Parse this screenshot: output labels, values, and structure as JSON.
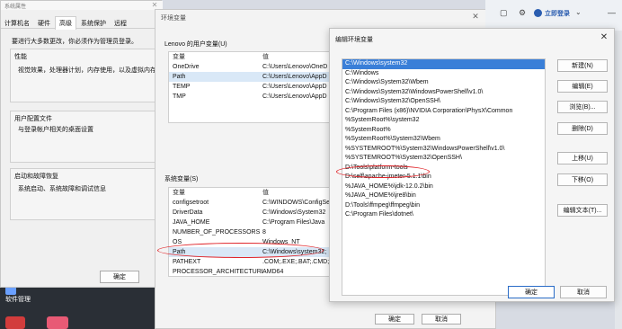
{
  "sysprop": {
    "title": "系统属性",
    "tabs": [
      "计算机名",
      "硬件",
      "高级",
      "系统保护",
      "远程"
    ],
    "admin_note": "要进行大多数更改，你必须作为管理员登录。",
    "perf_label": "性能",
    "perf_text": "视觉效果，处理器计划，内存使用，以及虚拟内存",
    "profile_label": "用户配置文件",
    "profile_text": "与登录帐户相关的桌面设置",
    "startup_label": "启动和故障恢复",
    "startup_text": "系统启动、系统故障和调试信息",
    "ok": "确定"
  },
  "desktop": {
    "label": "软件管理"
  },
  "envvar": {
    "title": "环境变量",
    "user_section": "Lenovo 的用户变量(U)",
    "col_var": "变量",
    "col_val": "值",
    "user_vars": [
      {
        "name": "OneDrive",
        "value": "C:\\Users\\Lenovo\\OneD"
      },
      {
        "name": "Path",
        "value": "C:\\Users\\Lenovo\\AppD"
      },
      {
        "name": "TEMP",
        "value": "C:\\Users\\Lenovo\\AppD"
      },
      {
        "name": "TMP",
        "value": "C:\\Users\\Lenovo\\AppD"
      }
    ],
    "system_section": "系统变量(S)",
    "sys_vars": [
      {
        "name": "configsetroot",
        "value": "C:\\WINDOWS\\ConfigSe"
      },
      {
        "name": "DriverData",
        "value": "C:\\Windows\\System32"
      },
      {
        "name": "JAVA_HOME",
        "value": "C:\\Program Files\\Java"
      },
      {
        "name": "NUMBER_OF_PROCESSORS",
        "value": "8"
      },
      {
        "name": "OS",
        "value": "Windows_NT"
      },
      {
        "name": "Path",
        "value": "C:\\Windows\\system32;"
      },
      {
        "name": "PATHEXT",
        "value": ".COM;.EXE;.BAT;.CMD;."
      },
      {
        "name": "PROCESSOR_ARCHITECTURE",
        "value": "AMD64"
      }
    ],
    "ok": "确定",
    "cancel": "取消"
  },
  "browser": {
    "login": "立即登录"
  },
  "editenv": {
    "title": "编辑环境变量",
    "entries": [
      "C:\\Windows\\system32",
      "C:\\Windows",
      "C:\\Windows\\System32\\Wbem",
      "C:\\Windows\\System32\\WindowsPowerShell\\v1.0\\",
      "C:\\Windows\\System32\\OpenSSH\\",
      "C:\\Program Files (x86)\\NVIDIA Corporation\\PhysX\\Common",
      "%SystemRoot%\\system32",
      "%SystemRoot%",
      "%SystemRoot%\\System32\\Wbem",
      "%SYSTEMROOT%\\System32\\WindowsPowerShell\\v1.0\\",
      "%SYSTEMROOT%\\System32\\OpenSSH\\",
      "D:\\Tools\\platform-tools",
      "D:\\self\\apache-jmeter-5.1.1\\bin",
      "%JAVA_HOME%\\jdk-12.0.2\\bin",
      "%JAVA_HOME%\\jre8\\bin",
      "D:\\Tools\\ffmpeg\\ffmpeg\\bin",
      "C:\\Program Files\\dotnet\\"
    ],
    "selected_index": 0,
    "buttons": [
      "新建(N)",
      "编辑(E)",
      "浏览(B)...",
      "删除(D)",
      "上移(U)",
      "下移(O)",
      "编辑文本(T)..."
    ],
    "ok": "确定",
    "cancel": "取消"
  },
  "colors": {
    "selection": "#3a7fd8",
    "annotation": "#e0262b"
  }
}
